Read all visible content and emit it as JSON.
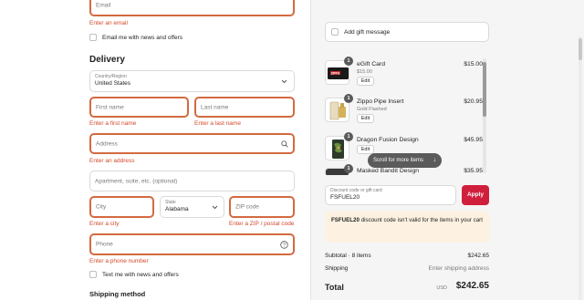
{
  "contact": {
    "email_placeholder": "Email",
    "email_error": "Enter an email",
    "news_label": "Email me with news and offers"
  },
  "delivery": {
    "heading": "Delivery",
    "country_label": "Country/Region",
    "country_value": "United States",
    "first_name_placeholder": "First name",
    "first_name_error": "Enter a first name",
    "last_name_placeholder": "Last name",
    "last_name_error": "Enter a last name",
    "address_placeholder": "Address",
    "address_error": "Enter an address",
    "apartment_placeholder": "Apartment, suite, etc. (optional)",
    "city_placeholder": "City",
    "city_error": "Enter a city",
    "state_label": "State",
    "state_value": "Alabama",
    "zip_placeholder": "ZIP code",
    "zip_error": "Enter a ZIP / postal code",
    "phone_placeholder": "Phone",
    "phone_error": "Enter a phone number",
    "text_label": "Text me with news and offers"
  },
  "shipping": {
    "heading": "Shipping method"
  },
  "gift": {
    "label": "Add gift message"
  },
  "cart": {
    "items": [
      {
        "qty": "1",
        "name": "eGift Card",
        "variant": "$15.00",
        "edit": "Edit",
        "price": "$15.00"
      },
      {
        "qty": "1",
        "name": "Zippo Pipe Insert",
        "variant": "Gold Flashed",
        "edit": "Edit",
        "price": "$20.95"
      },
      {
        "qty": "1",
        "name": "Dragon Fusion Design",
        "variant": "",
        "edit": "Edit",
        "price": "$45.95"
      },
      {
        "qty": "1",
        "name": "Masked Bandit Design",
        "variant": "",
        "edit": "",
        "price": "$35.95"
      }
    ],
    "scroll_hint": "Scroll for more items"
  },
  "discount": {
    "label": "Discount code or gift card",
    "value": "FSFUEL20",
    "apply": "Apply",
    "warning_code": "FSFUEL20",
    "warning_text": "discount code isn't valid for the items in your cart"
  },
  "summary": {
    "subtotal_label": "Subtotal · 8 items",
    "subtotal_value": "$242.65",
    "shipping_label": "Shipping",
    "shipping_value": "Enter shipping address",
    "total_label": "Total",
    "total_currency": "USD",
    "total_value": "$242.65"
  },
  "colors": {
    "error": "#d3482b",
    "error_border": "#d36a3f",
    "apply": "#d01f3c",
    "warning_bg": "#fdf1e1"
  }
}
